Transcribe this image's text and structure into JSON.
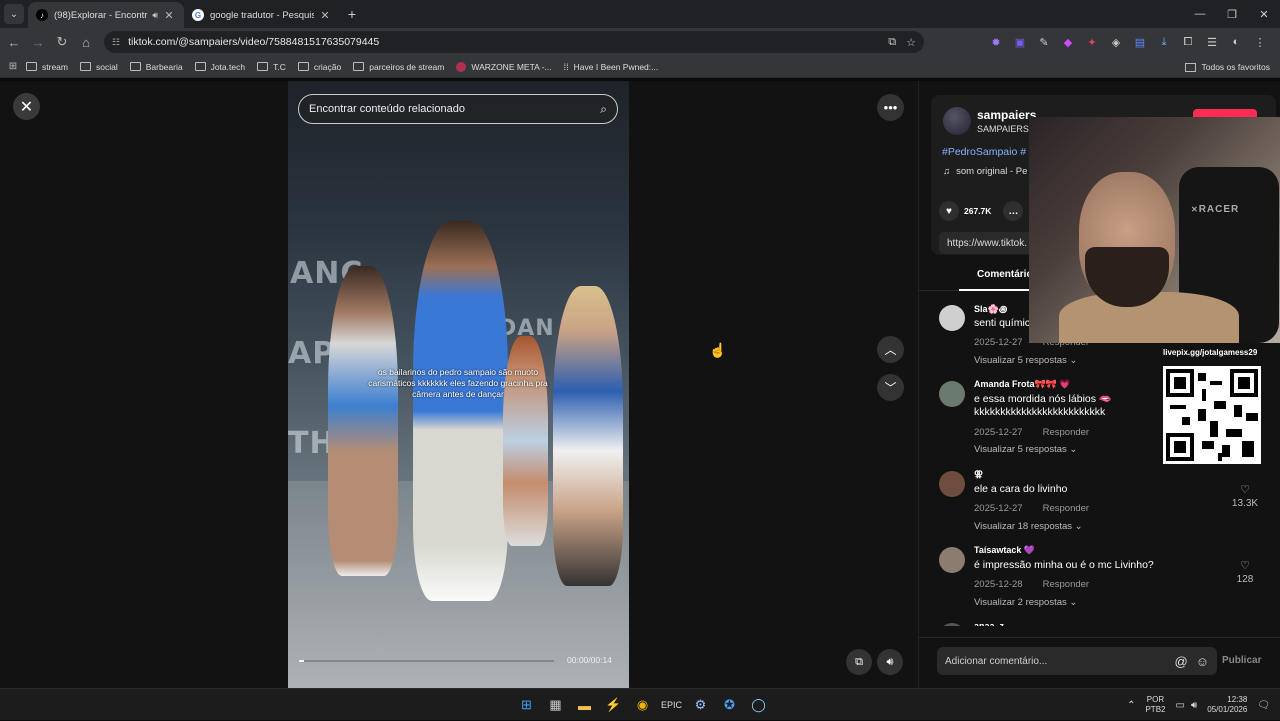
{
  "browser": {
    "tabs": [
      {
        "title": "(98)Explorar - Encontre seu",
        "active": true
      },
      {
        "title": "google tradutor - Pesquisa Goo",
        "active": false
      }
    ],
    "new_tab_label": "+",
    "url": "tiktok.com/@sampaiers/video/7588481517635079445",
    "bookmarks": [
      "stream",
      "social",
      "Barbearia",
      "Jota.tech",
      "T.C",
      "criação",
      "parceiros de stream",
      "WARZONE META -...",
      "Have I Been Pwned:..."
    ],
    "all_favorites": "Todos os favoritos"
  },
  "video": {
    "search_placeholder": "Encontrar conteúdo relacionado",
    "caption": "os bailarinos do pedro sampaio são muoto carismáticos kkkkkkk eles fazendo gracinha pra câmera antes de dançar",
    "time": "00:00/00:14",
    "progress_fraction": 0.02,
    "neon_text": [
      "ANC",
      "AP",
      "THI",
      "DAN"
    ]
  },
  "panel": {
    "username": "sampaiers",
    "nickname": "SAMPAIERS",
    "hashtags": "#PedroSampaio #",
    "sound": "som original - Pe",
    "likes": "267.7K",
    "link": "https://www.tiktok.",
    "comments_tab": "Comentário",
    "comments": [
      {
        "name": "Sla🌸꩜",
        "text": "senti química",
        "date": "2025-12-27",
        "reply": "Responder",
        "view": "Visualizar 5 respostas",
        "likes": "",
        "color": "#cfcfcf"
      },
      {
        "name": "Amanda Frota🎀🎀 💗",
        "text": "e essa mordida nós lábios 🫦 kkkkkkkkkkkkkkkkkkkkkkkkk",
        "date": "2025-12-27",
        "reply": "Responder",
        "view": "Visualizar 5 respostas",
        "likes": "",
        "color": "#6a7a6e"
      },
      {
        "name": "⚢",
        "text": "ele a cara do livinho",
        "date": "2025-12-27",
        "reply": "Responder",
        "view": "Visualizar 18 respostas",
        "likes": "13.3K",
        "color": "#6e4d3f"
      },
      {
        "name": "Taísawtack 💜",
        "text": "é impressão minha ou é o mc Livinho?",
        "date": "2025-12-28",
        "reply": "Responder",
        "view": "Visualizar 2 respostas",
        "likes": "128",
        "color": "#8c7b70"
      },
      {
        "name": "anaa_z",
        "text": "",
        "date": "",
        "reply": "",
        "view": "",
        "likes": "",
        "color": "#555"
      }
    ],
    "add_comment_placeholder": "Adicionar comentário...",
    "publish": "Publicar"
  },
  "webcam": {
    "chair_brand": "RACER",
    "livepix": "livepix.gg/jotalgamess29"
  },
  "taskbar": {
    "lang_top": "POR",
    "lang_bottom": "PTB2",
    "time": "12:38",
    "date": "05/01/2026"
  },
  "colors": {
    "accent": "#fe2c55",
    "hashtag": "#82b4ff"
  }
}
